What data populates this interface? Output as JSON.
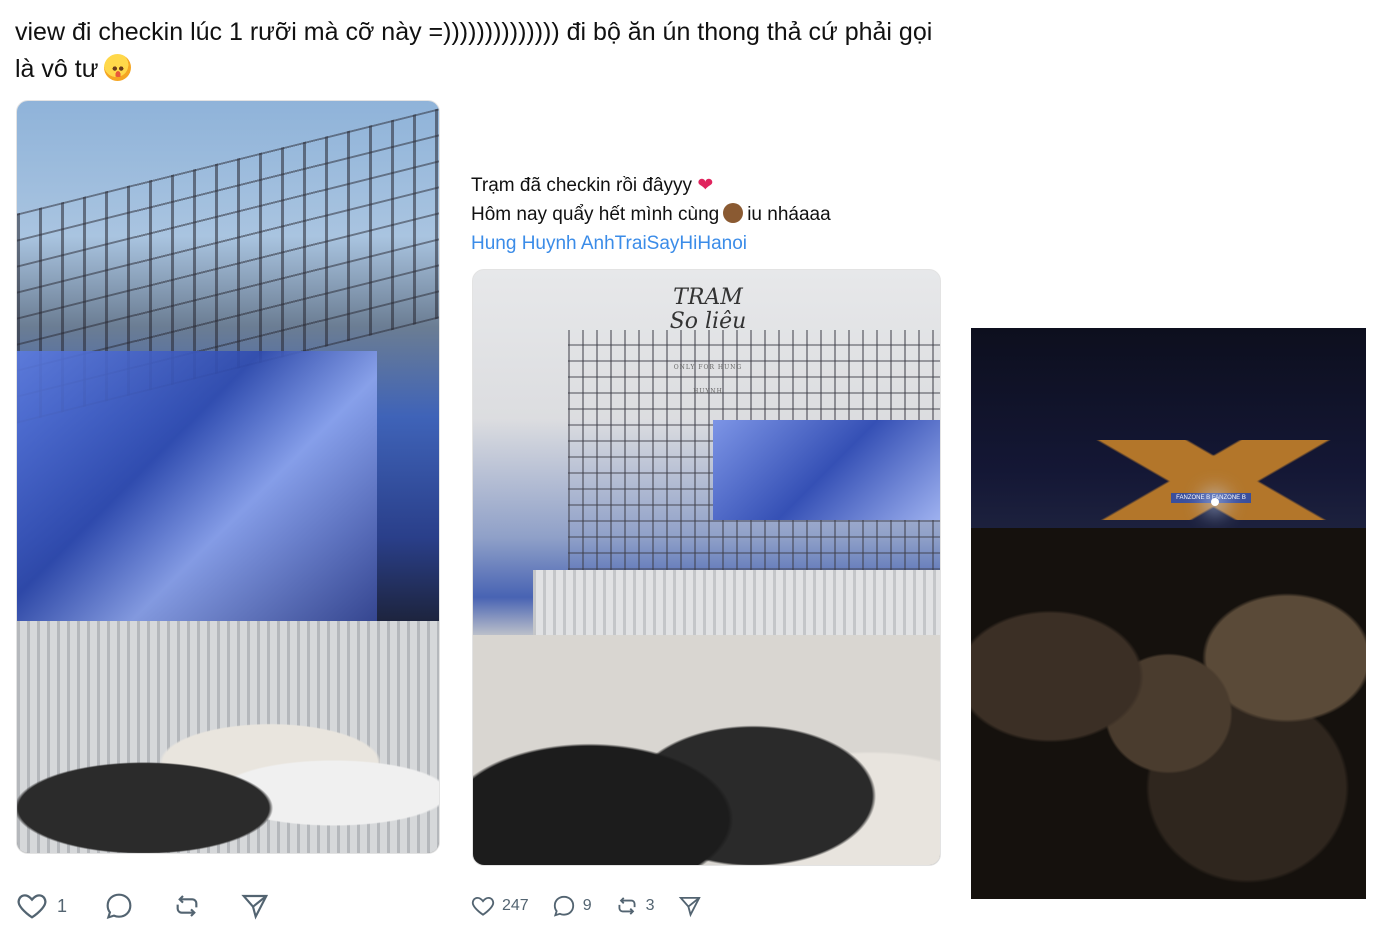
{
  "post1": {
    "text_line1": "view đi checkin lúc 1 rưỡi mà cỡ này =)))))))))))))) đi bộ ăn ún thong thả cứ phải gọi",
    "text_line2": "là vô tư",
    "emoji": "hot-face-emoji",
    "actions": {
      "like_count": "1",
      "reply_count": "",
      "repost_count": "",
      "share_count": ""
    }
  },
  "post2": {
    "line1": "Trạm đã checkin rồi đâyyy",
    "line1_emoji": "❤",
    "line2_before": "Hôm nay quẩy hết mình cùng",
    "line2_after": "iu nháaaa",
    "tags": "Hung Huynh AnhTraiSayHiHanoi",
    "watermark": {
      "title": "TRAM",
      "subtitle": "So liêu",
      "note": "ONLY FOR HUNG HUYNH"
    },
    "actions": {
      "like_count": "247",
      "reply_count": "9",
      "repost_count": "3"
    }
  },
  "photo3": {
    "sign_text": "FANZONE B FANZONE B"
  },
  "colors": {
    "link": "#3b8ce8",
    "icon": "#536471",
    "text": "#111111"
  }
}
